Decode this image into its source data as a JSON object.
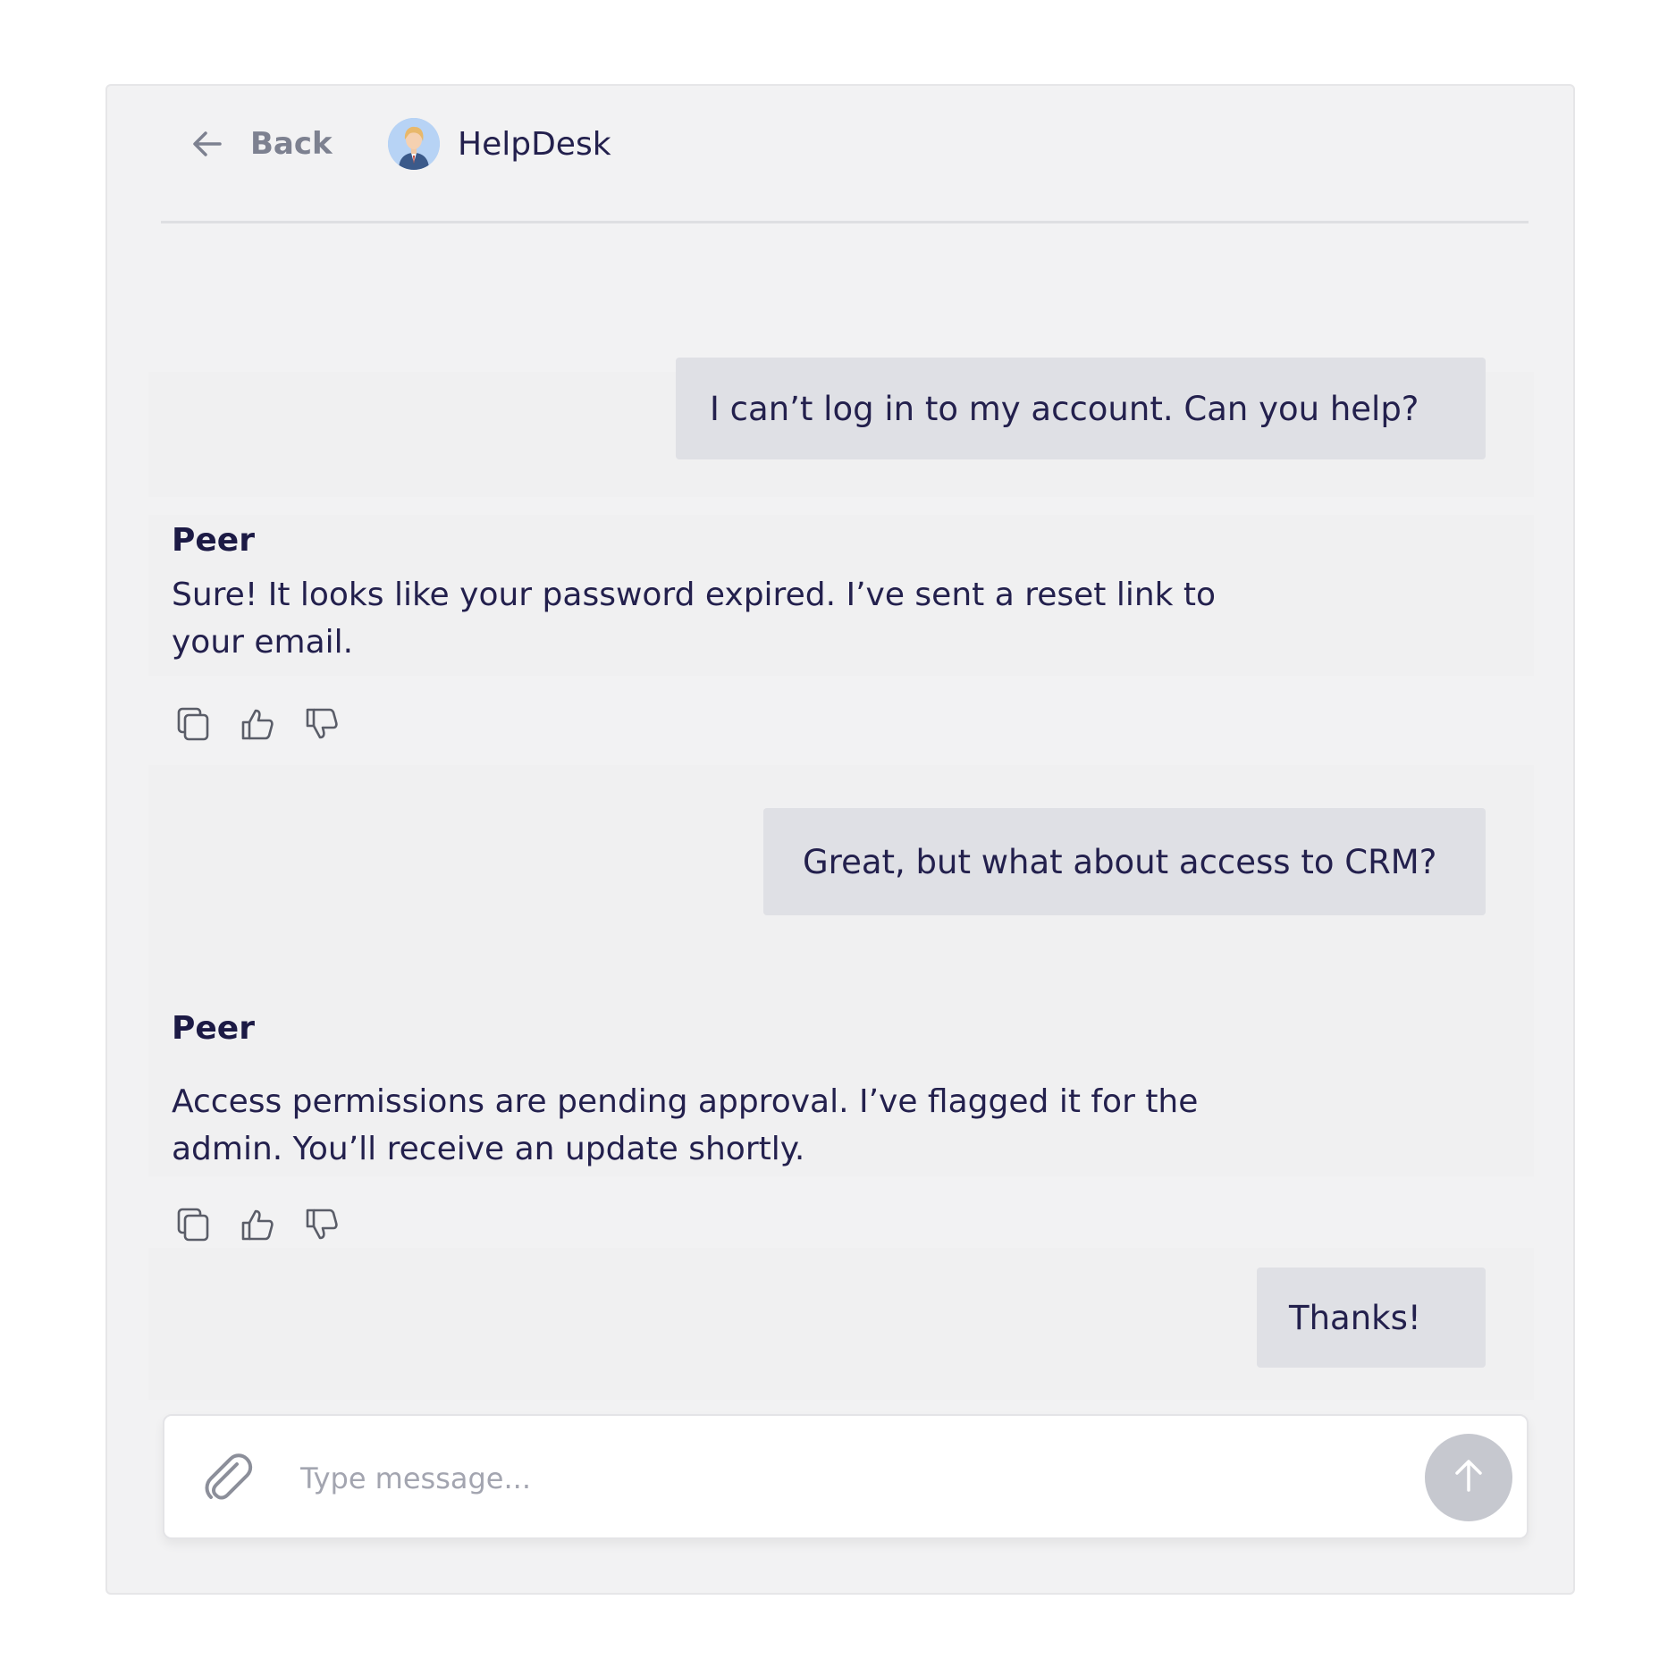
{
  "header": {
    "back_label": "Back",
    "agent_name": "HelpDesk",
    "back_icon": "arrow-left-icon",
    "avatar": "agent-avatar"
  },
  "messages": [
    {
      "role": "user",
      "text": "I can’t log in to my account. Can you help?"
    },
    {
      "role": "peer",
      "author": "Peer",
      "text": "Sure! It looks like your password expired. I’ve sent a reset link to your email."
    },
    {
      "role": "user",
      "text": "Great, but what about access to CRM?"
    },
    {
      "role": "peer",
      "author": "Peer",
      "text": "Access permissions are pending approval. I’ve flagged it for the admin. You’ll receive an update shortly."
    },
    {
      "role": "user",
      "text": "Thanks!"
    }
  ],
  "message_actions": [
    "copy-icon",
    "thumbs-up-icon",
    "thumbs-down-icon"
  ],
  "composer": {
    "placeholder": "Type message...",
    "attach_icon": "paperclip-icon",
    "send_icon": "arrow-up-icon"
  },
  "colors": {
    "text": "#23204d",
    "user_bubble": "#dfe0e5",
    "panel": "#f2f2f3",
    "send_button": "#c6c8cf"
  }
}
